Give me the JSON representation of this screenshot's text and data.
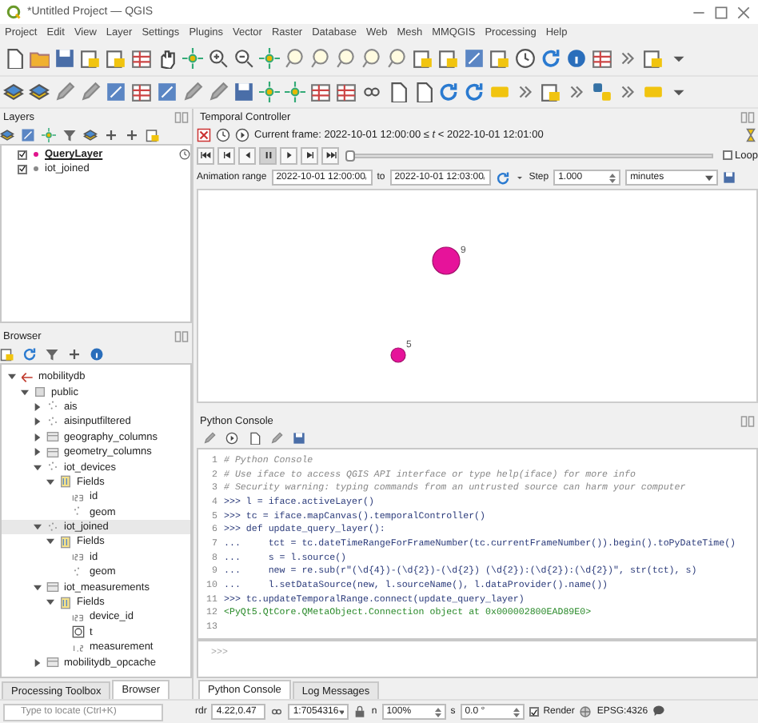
{
  "window": {
    "title": "*Untitled Project — QGIS"
  },
  "menu": [
    "Project",
    "Edit",
    "View",
    "Layer",
    "Settings",
    "Plugins",
    "Vector",
    "Raster",
    "Database",
    "Web",
    "Mesh",
    "MMQGIS",
    "Processing",
    "Help"
  ],
  "layers_panel": {
    "title": "Layers",
    "layers": [
      {
        "name": "QueryLayer",
        "checked": true,
        "selected": true,
        "color": "#e0148c"
      },
      {
        "name": "iot_joined",
        "checked": true,
        "selected": false,
        "color": "#8a8a8a"
      }
    ]
  },
  "browser_panel": {
    "title": "Browser",
    "tree": [
      {
        "name": "mobilitydb",
        "kind": "database",
        "expanded": true,
        "selected": false,
        "children": [
          {
            "name": "public",
            "kind": "schema",
            "expanded": true,
            "selected": false,
            "children": [
              {
                "name": "ais",
                "kind": "points",
                "expanded": false,
                "selected": false
              },
              {
                "name": "aisinputfiltered",
                "kind": "points",
                "expanded": false,
                "selected": false
              },
              {
                "name": "geography_columns",
                "kind": "table",
                "expanded": false,
                "selected": false
              },
              {
                "name": "geometry_columns",
                "kind": "table",
                "expanded": false,
                "selected": false
              },
              {
                "name": "iot_devices",
                "kind": "points",
                "expanded": true,
                "selected": false,
                "children": [
                  {
                    "name": "Fields",
                    "kind": "fields",
                    "expanded": true,
                    "selected": false,
                    "children": [
                      {
                        "name": "id",
                        "kind": "integer",
                        "selected": false
                      },
                      {
                        "name": "geom",
                        "kind": "geometry",
                        "selected": false
                      }
                    ]
                  }
                ]
              },
              {
                "name": "iot_joined",
                "kind": "points",
                "expanded": true,
                "selected": true,
                "children": [
                  {
                    "name": "Fields",
                    "kind": "fields",
                    "expanded": true,
                    "selected": false,
                    "children": [
                      {
                        "name": "id",
                        "kind": "integer",
                        "selected": false
                      },
                      {
                        "name": "geom",
                        "kind": "geometry",
                        "selected": false
                      }
                    ]
                  }
                ]
              },
              {
                "name": "iot_measurements",
                "kind": "table",
                "expanded": true,
                "selected": false,
                "children": [
                  {
                    "name": "Fields",
                    "kind": "fields",
                    "expanded": true,
                    "selected": false,
                    "children": [
                      {
                        "name": "device_id",
                        "kind": "integer",
                        "selected": false
                      },
                      {
                        "name": "t",
                        "kind": "datetime",
                        "selected": false
                      },
                      {
                        "name": "measurement",
                        "kind": "real",
                        "selected": false
                      }
                    ]
                  }
                ]
              },
              {
                "name": "mobilitydb_opcache",
                "kind": "table",
                "expanded": false,
                "selected": false
              }
            ]
          }
        ]
      }
    ]
  },
  "left_tabs": [
    {
      "label": "Processing Toolbox",
      "selected": false
    },
    {
      "label": "Browser",
      "selected": true
    }
  ],
  "locator": {
    "placeholder": "Type to locate (Ctrl+K)"
  },
  "temporal_controller": {
    "title": "Temporal Controller",
    "current_frame": "Current frame: 2022-10-01 12:00:00 ≤ *t* < 2022-10-01 12:01:00",
    "playback_buttons": [
      {
        "kind": "first",
        "selected": false
      },
      {
        "kind": "previous",
        "selected": false
      },
      {
        "kind": "back",
        "selected": false
      },
      {
        "kind": "pause",
        "selected": true
      },
      {
        "kind": "play",
        "selected": false
      },
      {
        "kind": "next",
        "selected": false
      },
      {
        "kind": "last",
        "selected": false
      }
    ],
    "slider": {
      "level": 0
    },
    "loop": {
      "label": "Loop",
      "checked": false
    },
    "range_label": "Animation range",
    "range_start": "2022-10-01 12:00:00",
    "to_label": "to",
    "range_end": "2022-10-01 12:03:00",
    "step_label": "Step",
    "step": "1.000",
    "unit": "minutes"
  },
  "map": {
    "points": [
      {
        "label": "9"
      },
      {
        "label": "5"
      }
    ]
  },
  "python_console": {
    "title": "Python Console",
    "lines": [
      {
        "number": "1",
        "kind": "comment",
        "text": "# Python Console"
      },
      {
        "number": "2",
        "kind": "comment",
        "text": "# Use iface to access QGIS API interface or type help(iface) for more info"
      },
      {
        "number": "3",
        "kind": "comment",
        "text": "# Security warning: typing commands from an untrusted source can harm your computer"
      },
      {
        "number": "4",
        "kind": "code",
        "text": ">>> l = iface.activeLayer()"
      },
      {
        "number": "5",
        "kind": "code",
        "text": ">>> tc = iface.mapCanvas().temporalController()"
      },
      {
        "number": "6",
        "kind": "code",
        "text": ">>> def update_query_layer():"
      },
      {
        "number": "7",
        "kind": "code",
        "text": "...     tct = tc.dateTimeRangeForFrameNumber(tc.currentFrameNumber()).begin().toPyDateTime()"
      },
      {
        "number": "8",
        "kind": "code",
        "text": "...     s = l.source()"
      },
      {
        "number": "9",
        "kind": "code",
        "text": "...     new = re.sub(r\"(\\d{4})-(\\d{2})-(\\d{2}) (\\d{2}):(\\d{2}):(\\d{2})\", str(tct), s)"
      },
      {
        "number": "10",
        "kind": "code",
        "text": "...     l.setDataSource(new, l.sourceName(), l.dataProvider().name())"
      },
      {
        "number": "11",
        "kind": "code",
        "text": ">>> tc.updateTemporalRange.connect(update_query_layer)"
      },
      {
        "number": "12",
        "kind": "output",
        "text": "<PyQt5.QtCore.QMetaObject.Connection object at 0x000002800EAD89E0>"
      },
      {
        "number": "13"
      }
    ],
    "prompt": ">>>"
  },
  "right_tabs": [
    {
      "label": "Python Console",
      "selected": true
    },
    {
      "label": "Log Messages",
      "selected": false
    }
  ],
  "status_bar": {
    "coordinate_label": "rdr",
    "coordinate": "4.22,0.47",
    "scale": "1:7054316",
    "magnifier_label": "n",
    "magnifier": "100%",
    "rotation_label": "s",
    "rotation": "0.0 °",
    "render": {
      "label": "Render",
      "checked": true
    },
    "crs": "EPSG:4326"
  }
}
